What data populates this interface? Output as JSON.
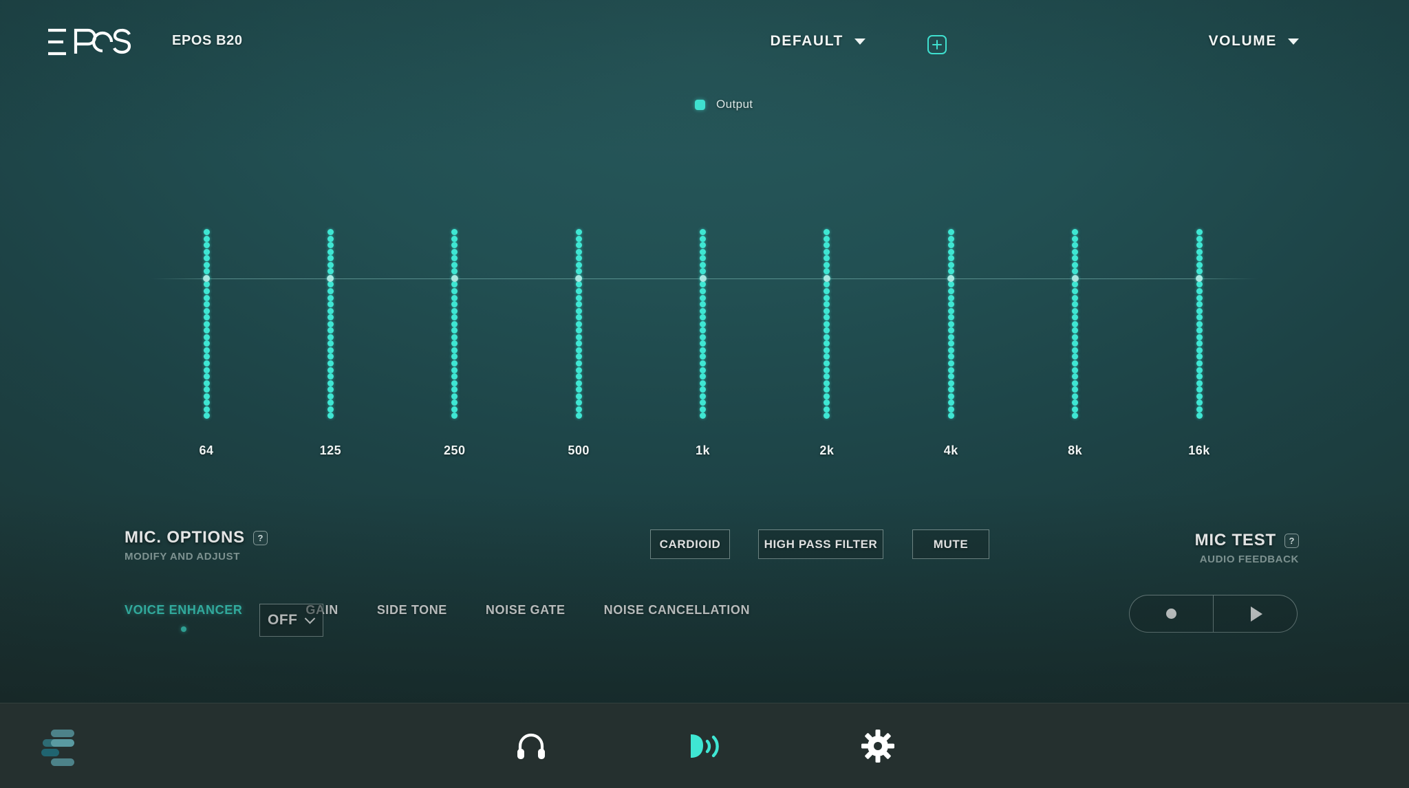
{
  "header": {
    "logo_text": "EPOS",
    "device_name": "EPOS B20",
    "preset": {
      "label": "DEFAULT",
      "icon": "chevron-down-icon"
    },
    "add_preset": {
      "icon": "plus-icon"
    },
    "volume": {
      "label": "VOLUME",
      "icon": "chevron-down-icon"
    }
  },
  "legend": {
    "label": "Output",
    "color": "#3fe0cf"
  },
  "chart_data": {
    "type": "line",
    "title": "",
    "xlabel": "",
    "ylabel": "",
    "legend": [
      "Output"
    ],
    "legend_position": "top-center",
    "grid": false,
    "categories": [
      "64",
      "125",
      "250",
      "500",
      "1k",
      "2k",
      "4k",
      "8k",
      "16k"
    ],
    "values": [
      0,
      0,
      0,
      0,
      0,
      0,
      0,
      0,
      0
    ],
    "ylim": [
      -12,
      12
    ],
    "units": "dB",
    "note": "Nine vertical dotted equaliser sliders; all bands flat at 0 dB on the centre line"
  },
  "mic_options": {
    "title": "MIC. OPTIONS",
    "help": "?",
    "subtitle": "MODIFY AND ADJUST"
  },
  "mic_test": {
    "title": "MIC TEST",
    "help": "?",
    "subtitle": "AUDIO FEEDBACK",
    "record_icon": "record-icon",
    "play_icon": "play-icon"
  },
  "toggles": [
    {
      "label": "CARDIOID",
      "active": false
    },
    {
      "label": "HIGH PASS FILTER",
      "active": false
    },
    {
      "label": "MUTE",
      "active": false
    }
  ],
  "tabs": [
    {
      "label": "VOICE ENHANCER",
      "active": true
    },
    {
      "label": "GAIN",
      "active": false
    },
    {
      "label": "SIDE TONE",
      "active": false
    },
    {
      "label": "NOISE GATE",
      "active": false
    },
    {
      "label": "NOISE CANCELLATION",
      "active": false
    }
  ],
  "voice_enhancer_select": {
    "value": "OFF",
    "icon": "chevron-down-icon"
  },
  "bottom_nav": [
    {
      "name": "headset",
      "icon": "headphones-icon",
      "active": false
    },
    {
      "name": "mic",
      "icon": "speaking-head-icon",
      "active": true
    },
    {
      "name": "settings",
      "icon": "gear-icon",
      "active": false
    }
  ],
  "colors": {
    "accent": "#3fe6d3",
    "background_center": "#27585b",
    "background_edge": "#1e2d2c",
    "bottom_bar": "#25302f",
    "text": "#ffffff"
  }
}
